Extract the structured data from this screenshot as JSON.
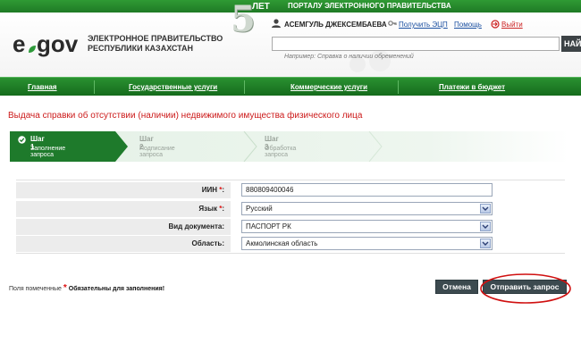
{
  "topbar": {
    "portal_title": "ПОРТАЛУ ЭЛЕКТРОННОГО ПРАВИТЕЛЬСТВА"
  },
  "badge": {
    "number": "5",
    "label": "ЛЕТ"
  },
  "logo": {
    "e": "e",
    "gov": "gov",
    "line1": "ЭЛЕКТРОННОЕ ПРАВИТЕЛЬСТВО",
    "line2": "РЕСПУБЛИКИ КАЗАХСТАН"
  },
  "user": {
    "name": "АСЕМГУЛЬ ДЖЕКСЕМБАЕВА",
    "get_eds_label": "Получить ЭЦП",
    "help_label": "Помощь",
    "exit_label": "Выйти"
  },
  "search": {
    "value": "",
    "button_label": "НАЙ",
    "hint": "Например: Справка о наличии обременений"
  },
  "nav": {
    "items": [
      "Главная",
      "Государственные услуги",
      "Коммерческие услуги",
      "Платежи в бюджет"
    ]
  },
  "page_title": "Выдача справки об отсутствии (наличии) недвижимого имущества физического лица",
  "steps": [
    {
      "title": "Шаг 1",
      "subtitle": "Заполнение запроса"
    },
    {
      "title": "Шаг 2",
      "subtitle": "Подписание запроса"
    },
    {
      "title": "Шаг 3",
      "subtitle": "Обработка запроса"
    }
  ],
  "form": {
    "iin_label": "ИИН",
    "iin_value": "880809400046",
    "language_label": "Язык",
    "language_value": "Русский",
    "doc_type_label": "Вид документа:",
    "doc_type_value": "ПАСПОРТ РК",
    "region_label": "Область:",
    "region_value": "Акмолинская область",
    "required_mark": "*",
    "colon": ":"
  },
  "footer": {
    "note_prefix": "Поля помеченные",
    "required_star": "*",
    "note_bold": "Обязательны для заполнения!",
    "cancel_label": "Отмена",
    "submit_label": "Отправить запрос"
  },
  "colors": {
    "brand_green": "#1f7a25",
    "step_active": "#1e7a2b",
    "title_red": "#cc1a1a",
    "highlight_ellipse": "#d01010"
  }
}
